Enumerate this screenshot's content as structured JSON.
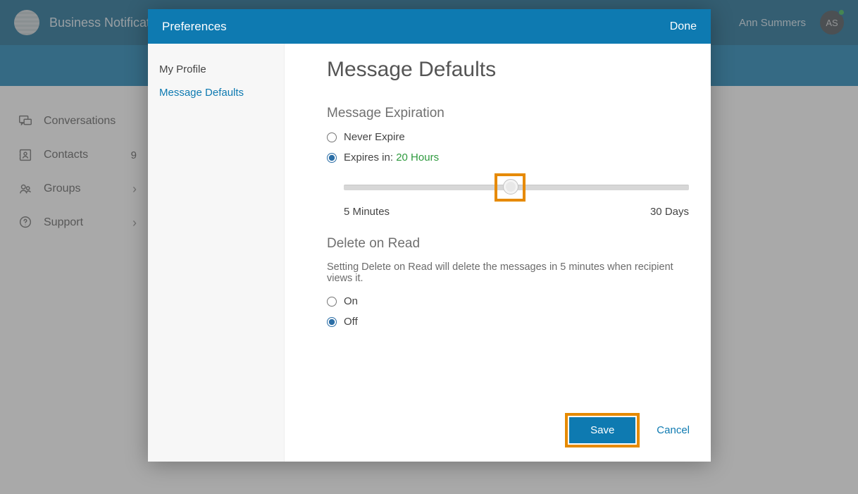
{
  "header": {
    "app_title": "Business Notification",
    "user_name": "Ann Summers",
    "avatar_initials": "AS"
  },
  "side_nav": {
    "items": [
      {
        "label": "Conversations",
        "badge": "",
        "has_chevron": false
      },
      {
        "label": "Contacts",
        "badge": "9",
        "has_chevron": false
      },
      {
        "label": "Groups",
        "badge": "",
        "has_chevron": true
      },
      {
        "label": "Support",
        "badge": "",
        "has_chevron": true
      }
    ]
  },
  "modal": {
    "title": "Preferences",
    "done_label": "Done",
    "sidebar": {
      "items": [
        {
          "label": "My Profile",
          "active": false
        },
        {
          "label": "Message Defaults",
          "active": true
        }
      ]
    },
    "page_title": "Message Defaults",
    "expiration": {
      "section_title": "Message Expiration",
      "never_label": "Never Expire",
      "expires_prefix": "Expires in:",
      "expires_value": "20 Hours",
      "slider_min_label": "5 Minutes",
      "slider_max_label": "30 Days",
      "selected": "expires"
    },
    "delete_on_read": {
      "section_title": "Delete on Read",
      "help_text": "Setting Delete on Read will delete the messages in 5 minutes when recipient views it.",
      "on_label": "On",
      "off_label": "Off",
      "selected": "off"
    },
    "footer": {
      "save_label": "Save",
      "cancel_label": "Cancel"
    }
  },
  "colors": {
    "primary": "#0e7ab1",
    "highlight": "#e68a00",
    "success_text": "#2e9a3e"
  }
}
